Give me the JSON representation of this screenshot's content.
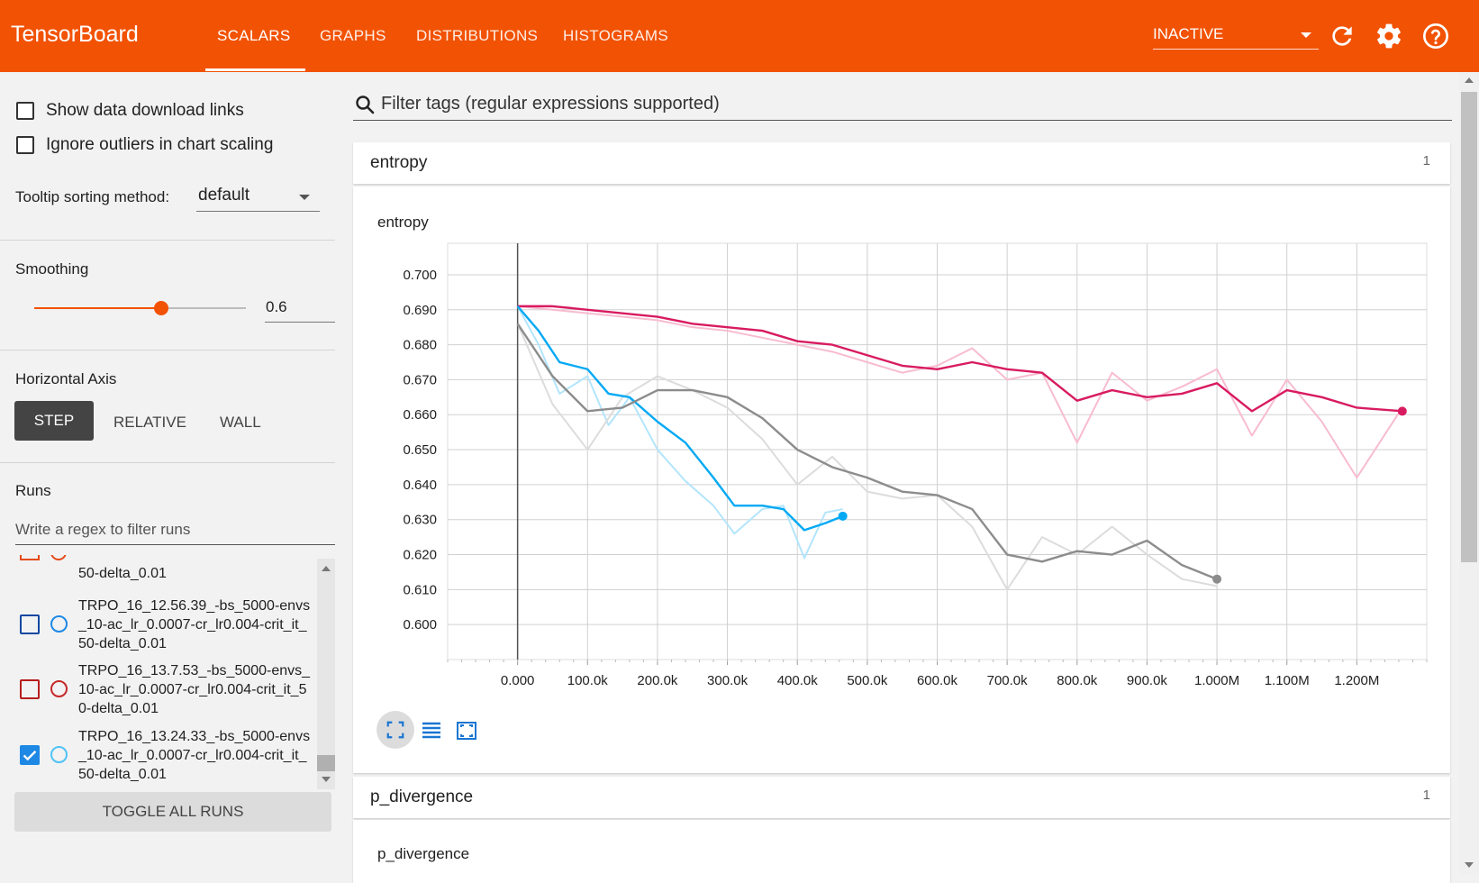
{
  "header": {
    "brand": "TensorBoard",
    "tabs": [
      "SCALARS",
      "GRAPHS",
      "DISTRIBUTIONS",
      "HISTOGRAMS"
    ],
    "active_tab": "SCALARS",
    "status_select": "INACTIVE",
    "icons": [
      "refresh-icon",
      "settings-gear-icon",
      "help-icon"
    ]
  },
  "sidebar": {
    "show_download_links": "Show data download links",
    "ignore_outliers": "Ignore outliers in chart scaling",
    "tooltip_label": "Tooltip sorting method:",
    "tooltip_value": "default",
    "smoothing_label": "Smoothing",
    "smoothing_value": "0.6",
    "smoothing_fraction": 0.6,
    "horizontal_axis_label": "Horizontal Axis",
    "axis_options": [
      "STEP",
      "RELATIVE",
      "WALL"
    ],
    "axis_selected": "STEP",
    "runs_label": "Runs",
    "runs_filter_placeholder": "Write a regex to filter runs",
    "runs": [
      {
        "label": "50-delta_0.01",
        "color": "#e64a19",
        "checked": false,
        "partial": true
      },
      {
        "label": "TRPO_16_12.56.39_-bs_5000-envs_10-ac_lr_0.0007-cr_lr0.004-crit_it_50-delta_0.01",
        "color": "#0d47a1",
        "checked": false
      },
      {
        "label": "TRPO_16_13.7.53_-bs_5000-envs_10-ac_lr_0.0007-cr_lr0.004-crit_it_50-delta_0.01",
        "color": "#b71c1c",
        "checked": false
      },
      {
        "label": "TRPO_16_13.24.33_-bs_5000-envs_10-ac_lr_0.0007-cr_lr0.004-crit_it_50-delta_0.01",
        "color": "#1e88e5",
        "checked": true
      }
    ],
    "run_line_lines": [
      [
        "50-delta_0.01"
      ],
      [
        "TRPO_16_12.56.39_-bs_5000-envs",
        "_10-ac_lr_0.0007-cr_lr0.004-crit_it_",
        "50-delta_0.01"
      ],
      [
        "TRPO_16_13.7.53_-bs_5000-envs_",
        "10-ac_lr_0.0007-cr_lr0.004-crit_it_5",
        "0-delta_0.01"
      ],
      [
        "TRPO_16_13.24.33_-bs_5000-envs",
        "_10-ac_lr_0.0007-cr_lr0.004-crit_it_",
        "50-delta_0.01"
      ]
    ],
    "toggle_all": "TOGGLE ALL RUNS"
  },
  "main": {
    "filter_placeholder": "Filter tags (regular expressions supported)",
    "cards": [
      {
        "tag": "entropy",
        "count": "1"
      },
      {
        "tag": "p_divergence",
        "count": "1"
      }
    ],
    "chart_titles": [
      "entropy",
      "p_divergence"
    ]
  },
  "chart_data": {
    "type": "line",
    "title": "entropy",
    "xlabel": "",
    "ylabel": "",
    "x_ticks": [
      "0.000",
      "100.0k",
      "200.0k",
      "300.0k",
      "400.0k",
      "500.0k",
      "600.0k",
      "700.0k",
      "800.0k",
      "900.0k",
      "1.000M",
      "1.100M",
      "1.200M"
    ],
    "y_ticks": [
      "0.600",
      "0.610",
      "0.620",
      "0.630",
      "0.640",
      "0.650",
      "0.660",
      "0.670",
      "0.680",
      "0.690",
      "0.700"
    ],
    "xlim": [
      -100000,
      1300000
    ],
    "ylim": [
      0.59,
      0.709
    ],
    "series": [
      {
        "color": "#d81b60",
        "raw_color": "#f8bbd0",
        "x": [
          0,
          50000,
          100000,
          150000,
          200000,
          250000,
          300000,
          350000,
          400000,
          450000,
          500000,
          550000,
          600000,
          650000,
          700000,
          750000,
          800000,
          850000,
          900000,
          950000,
          1000000,
          1050000,
          1100000,
          1150000,
          1200000,
          1265000
        ],
        "smoothed": [
          0.691,
          0.691,
          0.69,
          0.689,
          0.688,
          0.686,
          0.685,
          0.684,
          0.681,
          0.68,
          0.677,
          0.674,
          0.673,
          0.675,
          0.673,
          0.672,
          0.664,
          0.667,
          0.665,
          0.666,
          0.669,
          0.661,
          0.667,
          0.665,
          0.662,
          0.661
        ],
        "raw": [
          0.691,
          0.69,
          0.689,
          0.688,
          0.687,
          0.685,
          0.684,
          0.682,
          0.68,
          0.678,
          0.675,
          0.672,
          0.674,
          0.679,
          0.67,
          0.672,
          0.652,
          0.672,
          0.664,
          0.668,
          0.673,
          0.654,
          0.67,
          0.658,
          0.642,
          0.662
        ]
      },
      {
        "color": "#03a9f4",
        "raw_color": "#b3e5fc",
        "x": [
          0,
          30000,
          60000,
          100000,
          130000,
          160000,
          200000,
          240000,
          280000,
          310000,
          350000,
          380000,
          410000,
          440000,
          465000
        ],
        "smoothed": [
          0.691,
          0.684,
          0.675,
          0.673,
          0.666,
          0.665,
          0.658,
          0.652,
          0.642,
          0.634,
          0.634,
          0.633,
          0.627,
          0.629,
          0.631
        ],
        "raw": [
          0.691,
          0.68,
          0.666,
          0.671,
          0.657,
          0.665,
          0.65,
          0.641,
          0.634,
          0.626,
          0.633,
          0.634,
          0.619,
          0.632,
          0.633
        ]
      },
      {
        "color": "#8c8c8c",
        "raw_color": "#dcdcdc",
        "x": [
          0,
          50000,
          100000,
          150000,
          200000,
          250000,
          300000,
          350000,
          400000,
          450000,
          500000,
          550000,
          600000,
          650000,
          700000,
          750000,
          800000,
          850000,
          900000,
          950000,
          1000000
        ],
        "smoothed": [
          0.686,
          0.671,
          0.661,
          0.662,
          0.667,
          0.667,
          0.665,
          0.659,
          0.65,
          0.645,
          0.642,
          0.638,
          0.637,
          0.633,
          0.62,
          0.618,
          0.621,
          0.62,
          0.624,
          0.617,
          0.613
        ],
        "raw": [
          0.686,
          0.663,
          0.65,
          0.665,
          0.671,
          0.667,
          0.662,
          0.653,
          0.64,
          0.648,
          0.638,
          0.636,
          0.637,
          0.628,
          0.61,
          0.625,
          0.62,
          0.628,
          0.62,
          0.613,
          0.611
        ]
      }
    ]
  }
}
